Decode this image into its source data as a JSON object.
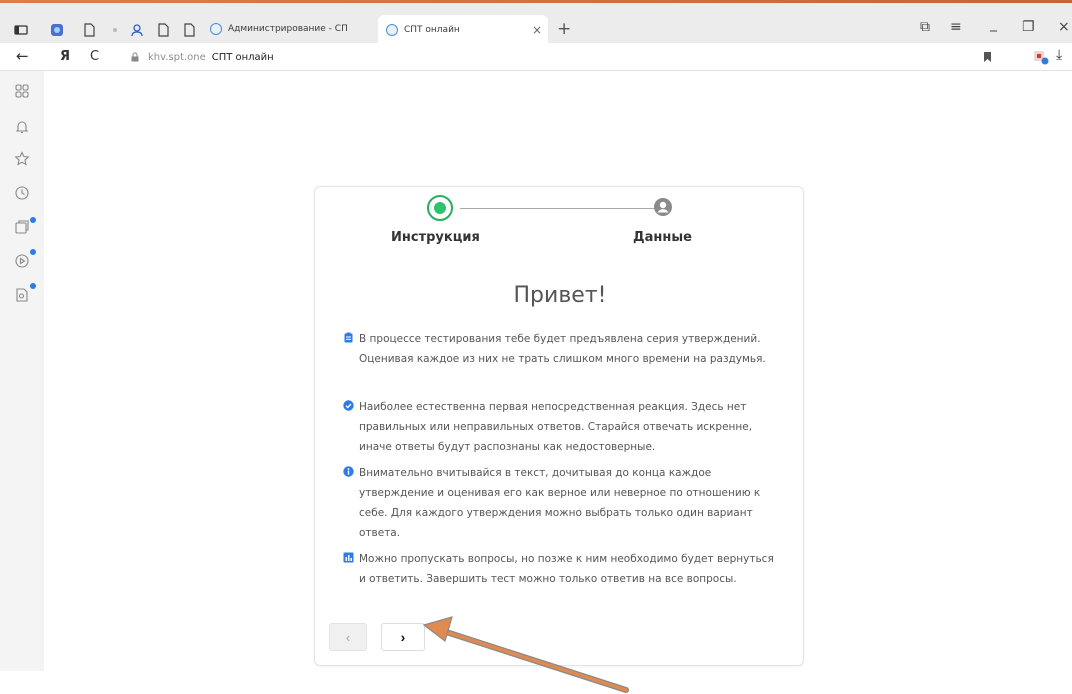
{
  "browser": {
    "tabs": [
      {
        "label": "Администрирование - СП"
      },
      {
        "label": "СПТ онлайн",
        "active": true
      }
    ],
    "tab_close": "×",
    "new_tab": "+",
    "nav": {
      "back": "←",
      "yandex": "Я",
      "reload": "C"
    },
    "address": {
      "host": "khv.spt.one",
      "page_title": "СПТ онлайн"
    },
    "window_controls": {
      "tabs_menu": "⧉",
      "menu": "≡",
      "minimize": "_",
      "restore": "❐",
      "close": "×"
    },
    "download": "⤓"
  },
  "card": {
    "steps": [
      {
        "label": "Инструкция",
        "state": "active"
      },
      {
        "label": "Данные",
        "state": "pending"
      }
    ],
    "greeting": "Привет!",
    "paragraphs": [
      {
        "icon": "clipboard-icon",
        "color": "#2f7be5",
        "text": "В процессе тестирования тебе будет предъявлена серия утверждений. Оценивая каждое из них не трать слишком много времени на раздумья."
      },
      {
        "icon": "check-circle-icon",
        "color": "#2f7be5",
        "text": "Наиболее естественна первая непосредственная реакция. Здесь нет правильных или неправильных ответов. Старайся отвечать искренне, иначе ответы будут распознаны как недостоверные."
      },
      {
        "icon": "info-circle-icon",
        "color": "#2f7be5",
        "text": "Внимательно вчитывайся в текст, дочитывая до конца каждое утверждение и оценивая его как верное или неверное по отношению к себе. Для каждого утверждения можно выбрать только один вариант ответа."
      },
      {
        "icon": "bar-chart-icon",
        "color": "#2f7be5",
        "text": "Можно пропускать вопросы, но позже к ним необходимо будет вернуться и ответить. Завершить тест можно только ответив на все вопросы."
      }
    ],
    "prev_label": "‹",
    "next_label": "›"
  },
  "colors": {
    "accent": "#2f7be5",
    "step_active": "#27ae60",
    "annotation_arrow": "#e08a4f"
  }
}
